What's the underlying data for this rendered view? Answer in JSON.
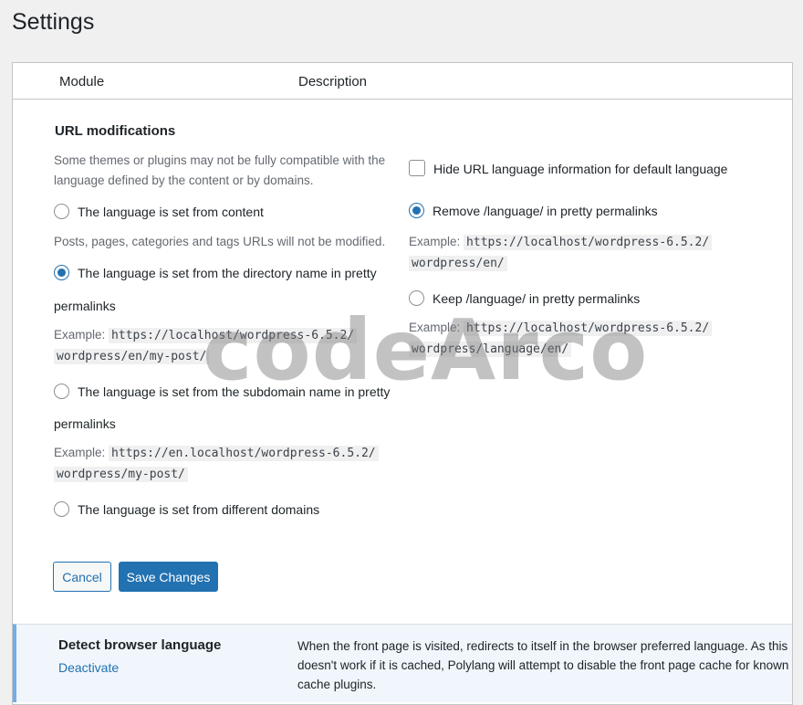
{
  "page": {
    "title": "Settings"
  },
  "table": {
    "col_module": "Module",
    "col_description": "Description"
  },
  "url_modifications": {
    "title": "URL modifications",
    "compat_note": "Some themes or plugins may not be fully compatible with the language defined by the content or by domains.",
    "options": [
      {
        "label": "The language is set from content",
        "checked": false,
        "note": "Posts, pages, categories and tags URLs will not be modified."
      },
      {
        "label_line1": "The language is set from the directory name in pretty",
        "label_line2": "permalinks",
        "checked": true,
        "example_label": "Example:",
        "example_code": "https://localhost/wordpress-6.5.2/wordpress/en/my-post/"
      },
      {
        "label_line1": "The language is set from the subdomain name in pretty",
        "label_line2": "permalinks",
        "checked": false,
        "example_label": "Example:",
        "example_code": "https://en.localhost/wordpress-6.5.2/wordpress/my-post/"
      },
      {
        "label": "The language is set from different domains",
        "checked": false
      }
    ],
    "right": {
      "hide_default": {
        "label": "Hide URL language information for default language",
        "checked": false
      },
      "remove_lang": {
        "label": "Remove /language/ in pretty permalinks",
        "checked": true,
        "example_label": "Example:",
        "example_code_1": "https://localhost/wordpress-6.5.2/",
        "example_code_2": "wordpress/en/"
      },
      "keep_lang": {
        "label": "Keep /language/ in pretty permalinks",
        "checked": false,
        "example_label": "Example:",
        "example_code_1": "https://localhost/wordpress-6.5.2/",
        "example_code_2": "wordpress/language/en/"
      }
    },
    "cancel_label": "Cancel",
    "save_label": "Save Changes"
  },
  "detect_browser": {
    "name": "Detect browser language",
    "action": "Deactivate",
    "description": "When the front page is visited, redirects to itself in the browser preferred language. As this doesn't work if it is cached, Polylang will attempt to disable the front page cache for known cache plugins."
  },
  "watermark": "codeArco",
  "colors": {
    "accent": "#2271b1",
    "active_row_bg": "#f0f6fc",
    "active_row_border": "#72aee6"
  }
}
